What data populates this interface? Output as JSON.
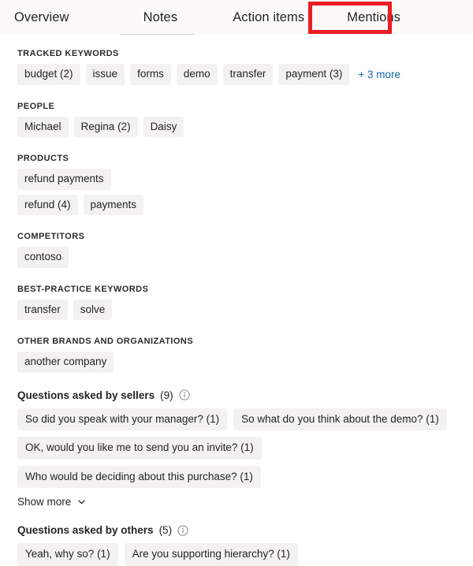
{
  "tabs": [
    {
      "label": "Overview",
      "selected": false
    },
    {
      "label": "Notes",
      "selected": false
    },
    {
      "label": "Action items",
      "selected": false
    },
    {
      "label": "Mentions",
      "selected": true
    }
  ],
  "highlight": {
    "color": "#ec1c24",
    "target": "Mentions"
  },
  "colors": {
    "chip_background": "#f3f2f1",
    "link": "#1264a3",
    "text": "#242424",
    "tabbar_background": "#fbfaf9",
    "highlight": "#ec1c24"
  },
  "sections": [
    {
      "label": "TRACKED KEYWORDS",
      "chips": [
        "budget (2)",
        "issue",
        "forms",
        "demo",
        "transfer",
        "payment (3)"
      ],
      "more_label": "+ 3 more"
    },
    {
      "label": "PEOPLE",
      "chips": [
        "Michael",
        "Regina (2)",
        "Daisy"
      ],
      "more_label": ""
    },
    {
      "label": "PRODUCTS",
      "chips": [
        "refund payments",
        "refund (4)",
        "payments"
      ],
      "more_label": ""
    },
    {
      "label": "COMPETITORS",
      "chips": [
        "contoso"
      ],
      "more_label": ""
    },
    {
      "label": "BEST-PRACTICE KEYWORDS",
      "chips": [
        "transfer",
        "solve"
      ],
      "more_label": ""
    },
    {
      "label": "OTHER BRANDS AND ORGANIZATIONS",
      "chips": [
        "another company"
      ],
      "more_label": ""
    }
  ],
  "questions_sellers": {
    "title": "Questions asked by sellers",
    "count": "(9)",
    "info_icon": "info-icon",
    "chips": [
      "So did you speak with your manager? (1)",
      "So what do you think about the demo? (1)",
      "OK, would you like me to send you an invite? (1)",
      "Who would be deciding about this purchase? (1)"
    ],
    "show_more_label": "Show more",
    "chevron_icon": "chevron-down-icon"
  },
  "questions_others": {
    "title": "Questions asked by others",
    "count": "(5)",
    "info_icon": "info-icon",
    "chips": [
      "Yeah, why so? (1)",
      "Are you supporting hierarchy? (1)"
    ]
  }
}
